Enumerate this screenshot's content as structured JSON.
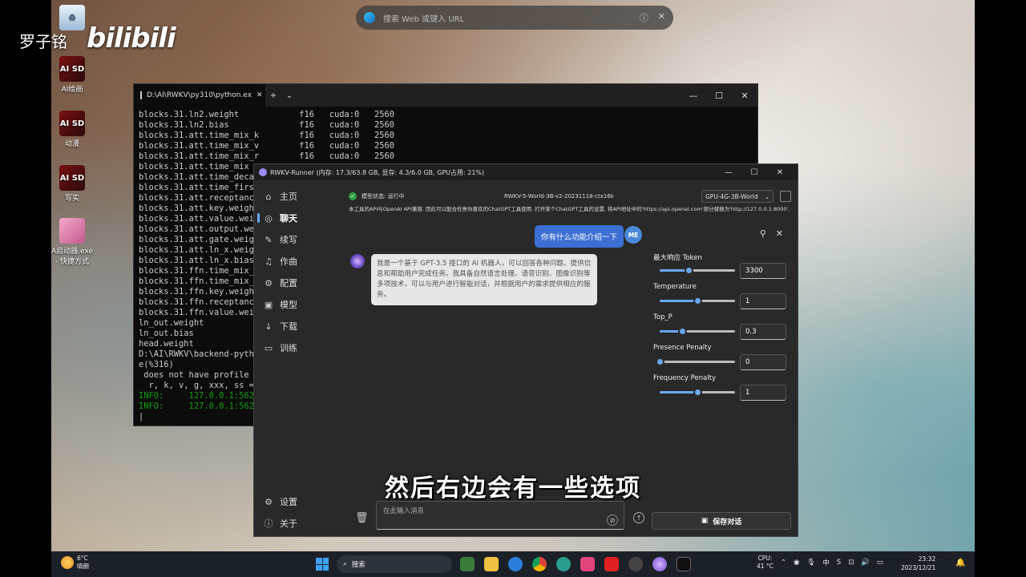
{
  "overlay": {
    "author": "罗子铭",
    "bilibili": "bilibili",
    "subtitle": "然后右边会有一些选项"
  },
  "desktop_icons": [
    {
      "label": "",
      "kind": "recycle"
    },
    {
      "label": "AI绘画",
      "badge": "AI SD",
      "kind": "sd"
    },
    {
      "label": "动漫",
      "badge": "AI SD",
      "kind": "sd"
    },
    {
      "label": "写实",
      "badge": "AI SD",
      "kind": "sd"
    },
    {
      "label": "A启动器.exe - 快捷方式",
      "badge": "",
      "kind": "anime"
    }
  ],
  "browser_search": {
    "placeholder": "搜索 Web 或键入 URL"
  },
  "terminal": {
    "tab_title": "D:\\AI\\RWKV\\py310\\python.ex",
    "lines": [
      "blocks.31.ln2.weight            f16   cuda:0   2560",
      "blocks.31.ln2.bias              f16   cuda:0   2560",
      "blocks.31.att.time_mix_k        f16   cuda:0   2560",
      "blocks.31.att.time_mix_v        f16   cuda:0   2560",
      "blocks.31.att.time_mix_r        f16   cuda:0   2560",
      "blocks.31.att.time_mix",
      "blocks.31.att.time_deca",
      "blocks.31.att.time_firs",
      "blocks.31.att.receptanc",
      "blocks.31.att.key.weigh",
      "blocks.31.att.value.wei",
      "blocks.31.att.output.we",
      "blocks.31.att.gate.weig",
      "blocks.31.att.ln_x.weig",
      "blocks.31.att.ln_x.bias",
      "blocks.31.ffn.time_mix_",
      "blocks.31.ffn.time_mix_",
      "blocks.31.ffn.key.weigh",
      "blocks.31.ffn.receptanc",
      "blocks.31.ffn.value.wei",
      "ln_out.weight",
      "ln_out.bias",
      "head.weight",
      "D:\\AI\\RWKV\\backend-pyth",
      "e(%316)",
      " does not have profile ",
      "  r, k, v, g, xxx, ss = "
    ],
    "info_lines": [
      "INFO:     127.0.0.1:562",
      "INFO:     127.0.0.1:562"
    ]
  },
  "rwkv": {
    "title": "RWKV-Runner (内存: 17.3/63.8 GB, 显存: 4.3/6.0 GB, GPU占用: 21%)",
    "nav": [
      {
        "label": "主页",
        "icon": "home-icon",
        "glyph": "⌂"
      },
      {
        "label": "聊天",
        "icon": "chat-icon",
        "glyph": "◎"
      },
      {
        "label": "续写",
        "icon": "edit-icon",
        "glyph": "✎"
      },
      {
        "label": "作曲",
        "icon": "music-icon",
        "glyph": "♫"
      },
      {
        "label": "配置",
        "icon": "config-icon",
        "glyph": "⚙"
      },
      {
        "label": "模型",
        "icon": "model-icon",
        "glyph": "▣"
      },
      {
        "label": "下载",
        "icon": "download-icon",
        "glyph": "↓"
      },
      {
        "label": "训练",
        "icon": "train-icon",
        "glyph": "▭"
      }
    ],
    "nav_bottom": [
      {
        "label": "设置",
        "icon": "settings-icon",
        "glyph": "⚙"
      },
      {
        "label": "关于",
        "icon": "info-icon",
        "glyph": "ⓘ"
      }
    ],
    "status": "模型状态: 运行中",
    "model": "RWKV-5-World-3B-v2-20231118-ctx16k",
    "preset": "GPU-4G-3B-World",
    "notice": "本工具的API与OpenAI API兼容. 因此可以配合任意你喜欢的ChatGPT工具使用. 打开某个ChatGPT工具的设置, 将API地址中的'https://api.openai.com'部分替换为'http://127.0.0.1:8000'.",
    "user_message": "你有什么功能介绍一下",
    "user_avatar": "ME",
    "bot_message": "我是一个基于 GPT-3.5 接口的 AI 机器人，可以回答各种问题、提供信息和帮助用户完成任务。我具备自然语言处理、语音识别、图像识别等多项技术，可以与用户进行智能对话，并根据用户的需求提供相应的服务。",
    "params": [
      {
        "label": "最大响应 Token",
        "value": "3300",
        "level": 0.38
      },
      {
        "label": "Temperature",
        "value": "1",
        "level": 0.5
      },
      {
        "label": "Top_P",
        "value": "0.3",
        "level": 0.3
      },
      {
        "label": "Presence Penalty",
        "value": "0",
        "level": 0.0
      },
      {
        "label": "Frequency Penalty",
        "value": "1",
        "level": 0.5
      }
    ],
    "input_placeholder": "在此输入消息",
    "save_label": "保存对话"
  },
  "taskbar": {
    "temperature": "6°C",
    "weather": "晴朗",
    "search_label": "搜索",
    "cpu_label": "CPU:",
    "cpu_temp": "41 °C",
    "ime": "中",
    "time": "23:32",
    "date": "2023/12/21"
  }
}
